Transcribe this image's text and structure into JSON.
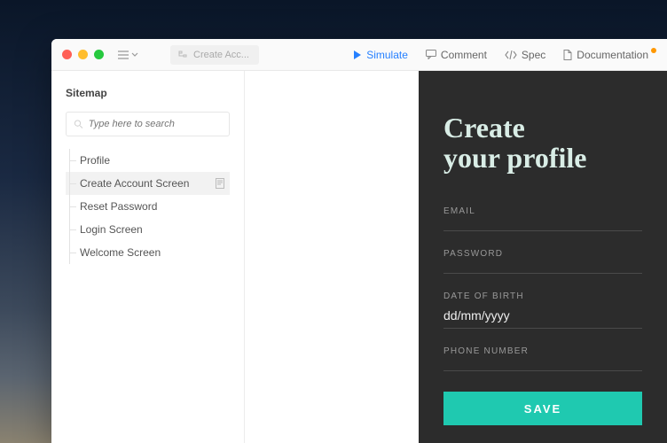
{
  "titlebar": {
    "breadcrumb": "Create Acc..."
  },
  "toolbar": {
    "simulate": "Simulate",
    "comment": "Comment",
    "spec": "Spec",
    "documentation": "Documentation"
  },
  "sidebar": {
    "title": "Sitemap",
    "search_placeholder": "Type here to search",
    "items": [
      {
        "label": "Profile"
      },
      {
        "label": "Create Account Screen"
      },
      {
        "label": "Reset Password"
      },
      {
        "label": "Login Screen"
      },
      {
        "label": "Welcome Screen"
      }
    ],
    "selected_index": 1
  },
  "preview": {
    "heading_line1": "Create",
    "heading_line2": "your profile",
    "fields": {
      "email": "EMAIL",
      "password": "PASSWORD",
      "dob": "DATE OF BIRTH",
      "dob_value": "dd/mm/yyyy",
      "phone": "PHONE NUMBER"
    },
    "save": "SAVE"
  },
  "colors": {
    "accent_blue": "#2680ff",
    "preview_bg": "#2c2c2c",
    "save_bg": "#1fc9b0",
    "heading_color": "#d9ede6"
  }
}
